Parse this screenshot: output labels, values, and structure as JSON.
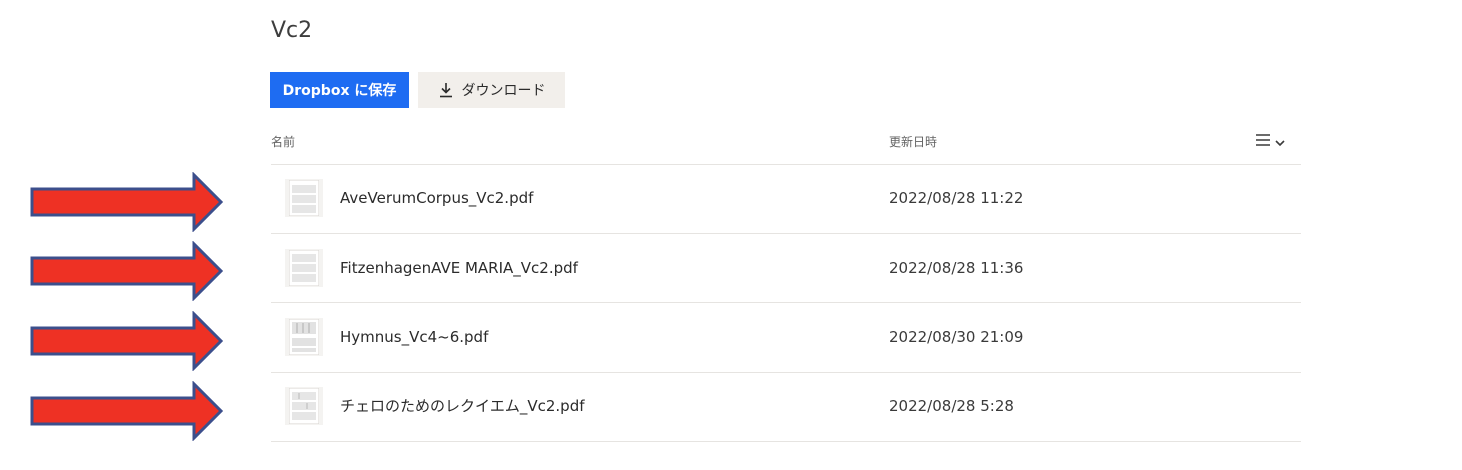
{
  "folder": {
    "title": "Vc2"
  },
  "toolbar": {
    "save_label": "Dropbox に保存",
    "download_label": "ダウンロード",
    "save_color": "#1e6cf2",
    "download_bg": "#f2efeb"
  },
  "table": {
    "headers": {
      "name": "名前",
      "modified": "更新日時"
    },
    "view_toggle_icon": "list-view-icon",
    "rows": [
      {
        "name": "AveVerumCorpus_Vc2.pdf",
        "modified": "2022/08/28 11:22",
        "icon": "pdf-thumbnail-icon"
      },
      {
        "name": "FitzenhagenAVE MARIA_Vc2.pdf",
        "modified": "2022/08/28 11:36",
        "icon": "pdf-thumbnail-icon"
      },
      {
        "name": "Hymnus_Vc4~6.pdf",
        "modified": "2022/08/30 21:09",
        "icon": "pdf-thumbnail-icon"
      },
      {
        "name": "チェロのためのレクイエム_Vc2.pdf",
        "modified": "2022/08/28 5:28",
        "icon": "pdf-thumbnail-icon"
      }
    ]
  },
  "annotations": {
    "arrow_icon": "right-arrow-icon",
    "arrow_fill": "#ee3124",
    "arrow_stroke": "#3c4f8c"
  }
}
